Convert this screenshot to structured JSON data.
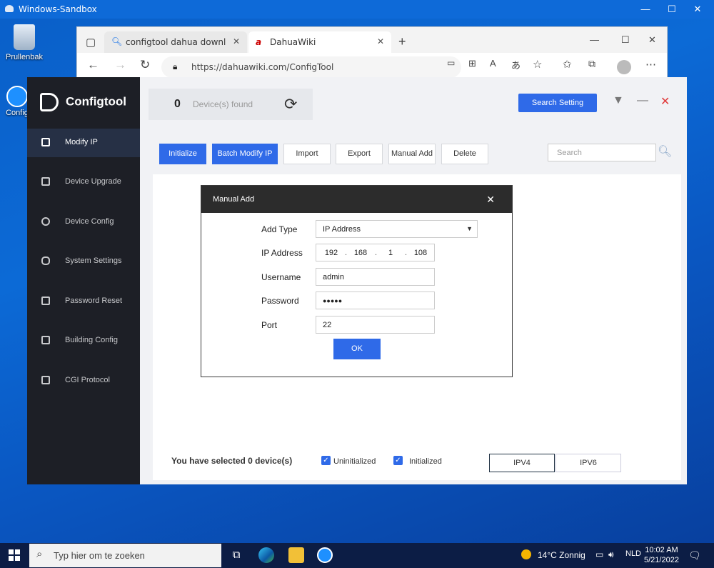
{
  "sandbox": {
    "title": "Windows-Sandbox"
  },
  "desktop": {
    "recycle_bin_label": "Prullenbak",
    "configtool_label": "Config"
  },
  "browser": {
    "tabs": [
      {
        "label": "configtool dahua download - Zo"
      },
      {
        "label": "DahuaWiki"
      }
    ],
    "url": "https://dahuawiki.com/ConfigTool"
  },
  "configtool": {
    "app_name": "Configtool",
    "device_count": "0",
    "device_found_label": "Device(s) found",
    "search_setting_label": "Search Setting",
    "sidebar": [
      {
        "label": "Modify IP",
        "icon": "modify-ip-icon"
      },
      {
        "label": "Device Upgrade",
        "icon": "upgrade-icon"
      },
      {
        "label": "Device Config",
        "icon": "config-icon"
      },
      {
        "label": "System Settings",
        "icon": "settings-icon"
      },
      {
        "label": "Password Reset",
        "icon": "lock-icon"
      },
      {
        "label": "Building Config",
        "icon": "building-icon"
      },
      {
        "label": "CGI Protocol",
        "icon": "cgi-icon"
      }
    ],
    "toolbar": {
      "initialize": "Initialize",
      "batch_modify_ip": "Batch Modify IP",
      "import": "Import",
      "export": "Export",
      "manual_add": "Manual Add",
      "delete": "Delete",
      "search_placeholder": "Search"
    },
    "footer": {
      "selected_text": "You have selected 0  device(s)",
      "uninitialized": "Uninitialized",
      "initialized": "Initialized",
      "ipv4": "IPV4",
      "ipv6": "IPV6"
    }
  },
  "dialog": {
    "title": "Manual Add",
    "fields": {
      "add_type_label": "Add Type",
      "add_type_value": "IP Address",
      "ip_label": "IP Address",
      "ip": [
        "192",
        "168",
        "1",
        "108"
      ],
      "username_label": "Username",
      "username_value": "admin",
      "password_label": "Password",
      "password_value": "●●●●●",
      "port_label": "Port",
      "port_value": "22"
    },
    "ok_label": "OK"
  },
  "taskbar": {
    "search_placeholder": "Typ hier om te zoeken",
    "weather": "14°C  Zonnig",
    "language": "NLD",
    "time": "10:02 AM",
    "date": "5/21/2022"
  }
}
